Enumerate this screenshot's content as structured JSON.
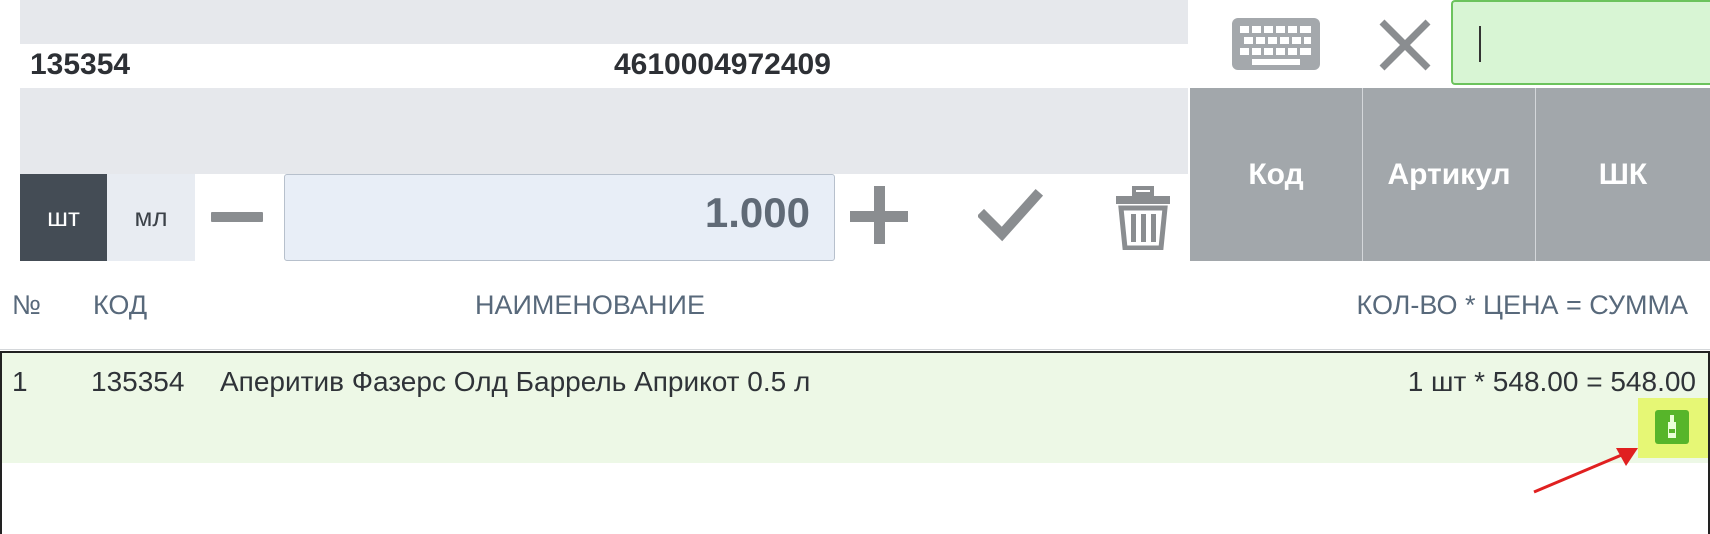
{
  "product": {
    "code": "135354",
    "barcode": "4610004972409"
  },
  "units": {
    "pcs": "шт",
    "ml": "мл"
  },
  "quantity": {
    "value": "1.000"
  },
  "search_modes": {
    "code": "Код",
    "article": "Артикул",
    "barcode": "ШК"
  },
  "table": {
    "headers": {
      "num": "№",
      "code": "КОД",
      "name": "НАИМЕНОВАНИЕ",
      "calc": "КОЛ-ВО * ЦЕНА = СУММА"
    },
    "rows": [
      {
        "num": "1",
        "code": "135354",
        "name": "Аперитив Фазерс Олд Баррель Априкот 0.5 л",
        "calc": "1 шт * 548.00 = 548.00"
      }
    ]
  },
  "icons": {
    "keyboard": "keyboard-icon",
    "close": "close-icon",
    "minus": "minus-icon",
    "plus": "plus-icon",
    "check": "check-icon",
    "trash": "trash-icon",
    "alcohol": "alcohol-bottle-icon"
  },
  "colors": {
    "accent_green": "#6cc35d",
    "active_unit": "#444c55",
    "search_mode_bg": "#a2a7ab",
    "row_highlight": "#edf8e6",
    "badge_bg": "#e6f775",
    "arrow": "#e02020"
  }
}
